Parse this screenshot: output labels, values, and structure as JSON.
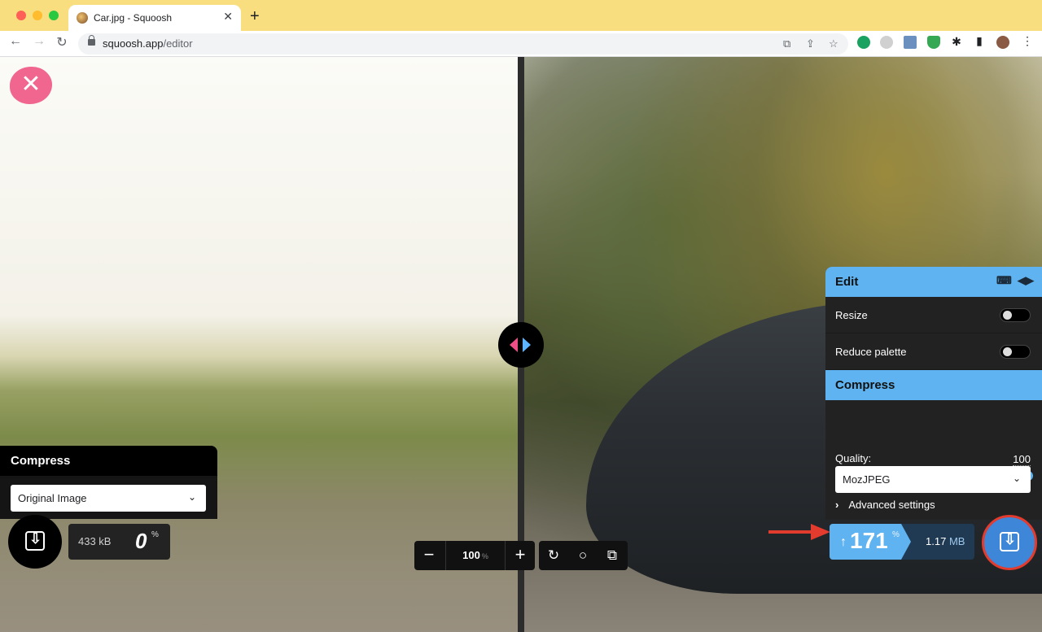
{
  "browser": {
    "tab_title": "Car.jpg - Squoosh",
    "tab_close": "✕",
    "new_tab": "+",
    "url_host": "squoosh.app",
    "url_path": "/editor"
  },
  "editor": {
    "close_symbol": "✕",
    "left_panel": {
      "title": "Compress",
      "method_selected": "Original Image",
      "file_size": "433 kB",
      "percent": "0",
      "percent_sign": "%"
    },
    "zoom": {
      "minus": "−",
      "value": "100",
      "unit": "%",
      "plus": "+"
    },
    "right_panel": {
      "edit_title": "Edit",
      "resize_label": "Resize",
      "resize_on": false,
      "reduce_palette_label": "Reduce palette",
      "reduce_palette_on": false,
      "compress_title": "Compress",
      "method_selected": "MozJPEG",
      "quality_label": "Quality:",
      "quality_value": "100",
      "advanced_label": "Advanced settings",
      "size_change_arrow": "↑",
      "size_change_percent": "171",
      "size_change_sign": "%",
      "file_size_value": "1.17",
      "file_size_unit": "MB"
    },
    "colors": {
      "accent_blue": "#5fb3f0",
      "accent_pink": "#f0668f",
      "highlight_red": "#e33b2e"
    }
  }
}
